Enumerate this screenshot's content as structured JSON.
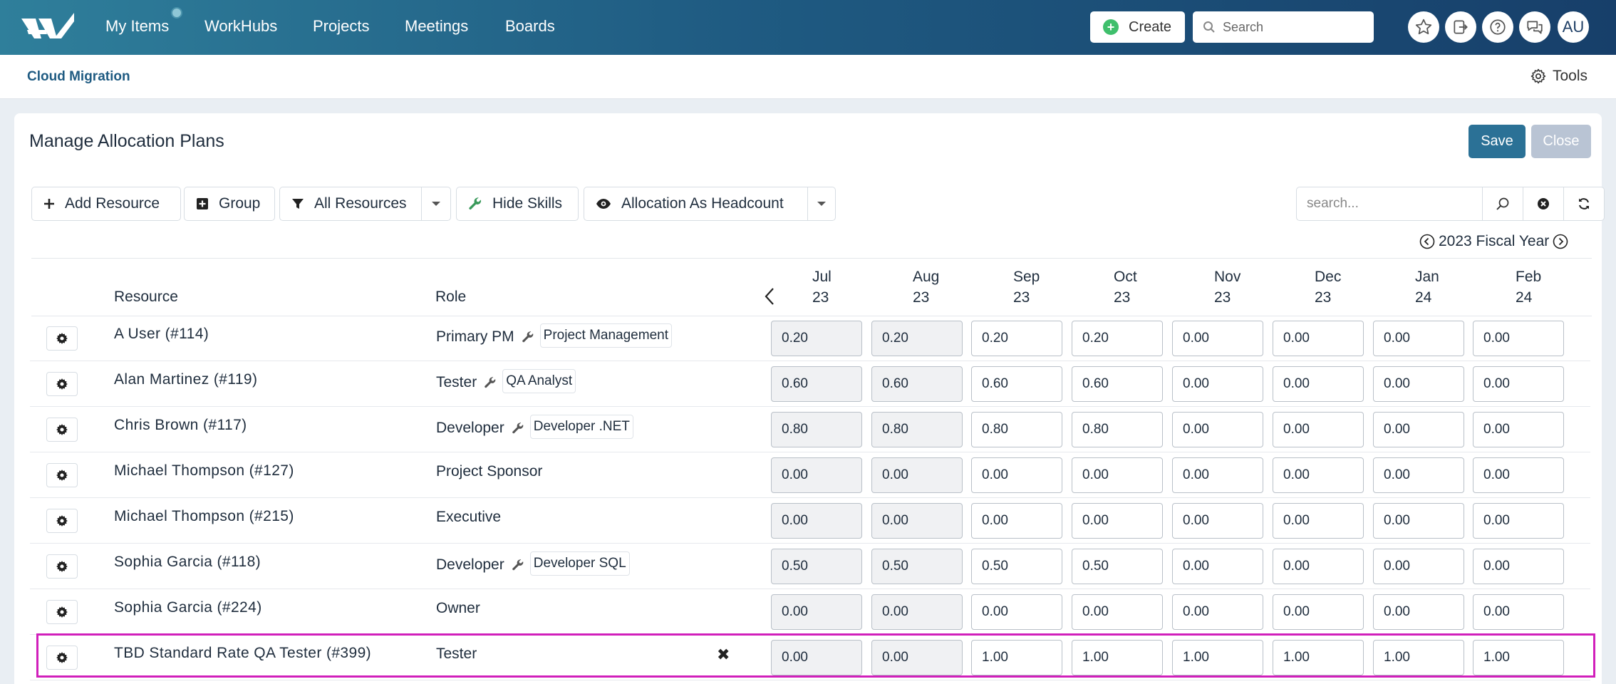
{
  "nav": {
    "items": [
      "My Items",
      "WorkHubs",
      "Projects",
      "Meetings",
      "Boards"
    ],
    "create_label": "Create",
    "search_placeholder": "Search",
    "avatar_initials": "AU"
  },
  "subheader": {
    "breadcrumb": "Cloud Migration",
    "tools_label": "Tools"
  },
  "page": {
    "title": "Manage Allocation Plans",
    "save_label": "Save",
    "close_label": "Close"
  },
  "toolbar": {
    "add_resource": "Add Resource",
    "group": "Group",
    "filter": "All Resources",
    "hide_skills": "Hide Skills",
    "allocation_mode": "Allocation As Headcount",
    "search_placeholder": "search..."
  },
  "fiscal_year": "2023 Fiscal Year",
  "columns": {
    "resource": "Resource",
    "role": "Role"
  },
  "months": [
    [
      "Jul",
      "23"
    ],
    [
      "Aug",
      "23"
    ],
    [
      "Sep",
      "23"
    ],
    [
      "Oct",
      "23"
    ],
    [
      "Nov",
      "23"
    ],
    [
      "Dec",
      "23"
    ],
    [
      "Jan",
      "24"
    ],
    [
      "Feb",
      "24"
    ]
  ],
  "locked_months": 2,
  "rows": [
    {
      "resource": "A User (#114)",
      "role": "Primary PM",
      "skill": "Project Management",
      "values": [
        "0.20",
        "0.20",
        "0.20",
        "0.20",
        "0.00",
        "0.00",
        "0.00",
        "0.00"
      ]
    },
    {
      "resource": "Alan Martinez (#119)",
      "role": "Tester",
      "skill": "QA Analyst",
      "values": [
        "0.60",
        "0.60",
        "0.60",
        "0.60",
        "0.00",
        "0.00",
        "0.00",
        "0.00"
      ]
    },
    {
      "resource": "Chris Brown (#117)",
      "role": "Developer",
      "skill": "Developer .NET",
      "values": [
        "0.80",
        "0.80",
        "0.80",
        "0.80",
        "0.00",
        "0.00",
        "0.00",
        "0.00"
      ]
    },
    {
      "resource": "Michael Thompson (#127)",
      "role": "Project Sponsor",
      "skill": "",
      "values": [
        "0.00",
        "0.00",
        "0.00",
        "0.00",
        "0.00",
        "0.00",
        "0.00",
        "0.00"
      ]
    },
    {
      "resource": "Michael Thompson (#215)",
      "role": "Executive",
      "skill": "",
      "values": [
        "0.00",
        "0.00",
        "0.00",
        "0.00",
        "0.00",
        "0.00",
        "0.00",
        "0.00"
      ]
    },
    {
      "resource": "Sophia Garcia (#118)",
      "role": "Developer",
      "skill": "Developer SQL",
      "values": [
        "0.50",
        "0.50",
        "0.50",
        "0.50",
        "0.00",
        "0.00",
        "0.00",
        "0.00"
      ]
    },
    {
      "resource": "Sophia Garcia (#224)",
      "role": "Owner",
      "skill": "",
      "values": [
        "0.00",
        "0.00",
        "0.00",
        "0.00",
        "0.00",
        "0.00",
        "0.00",
        "0.00"
      ]
    },
    {
      "resource": "TBD Standard Rate QA Tester (#399)",
      "role": "Tester",
      "skill": "",
      "removable": true,
      "values": [
        "0.00",
        "0.00",
        "1.00",
        "1.00",
        "1.00",
        "1.00",
        "1.00",
        "1.00"
      ]
    }
  ],
  "colors": {
    "accent": "#2b7196",
    "highlight": "#d11fbb",
    "create_plus": "#3fbf6c"
  }
}
